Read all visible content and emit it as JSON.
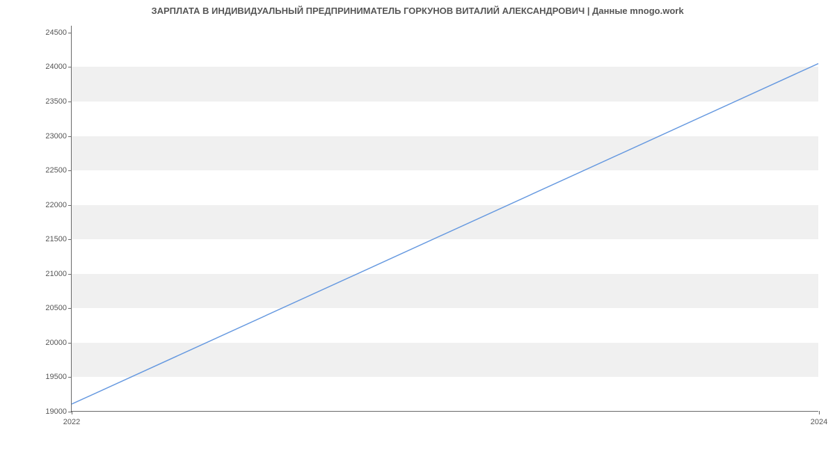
{
  "chart_data": {
    "type": "line",
    "title": "ЗАРПЛАТА В ИНДИВИДУАЛЬНЫЙ ПРЕДПРИНИМАТЕЛЬ ГОРКУНОВ ВИТАЛИЙ АЛЕКСАНДРОВИЧ | Данные mnogo.work",
    "x": [
      "2022",
      "2024"
    ],
    "values": [
      19100,
      24050
    ],
    "xlabel": "",
    "ylabel": "",
    "y_ticks": [
      19000,
      19500,
      20000,
      20500,
      21000,
      21500,
      22000,
      22500,
      23000,
      23500,
      24000,
      24500
    ],
    "x_ticks": [
      "2022",
      "2024"
    ],
    "ylim": [
      19000,
      24600
    ],
    "xlim": [
      2022,
      2024
    ],
    "grid": true,
    "line_color": "#6699e0"
  }
}
